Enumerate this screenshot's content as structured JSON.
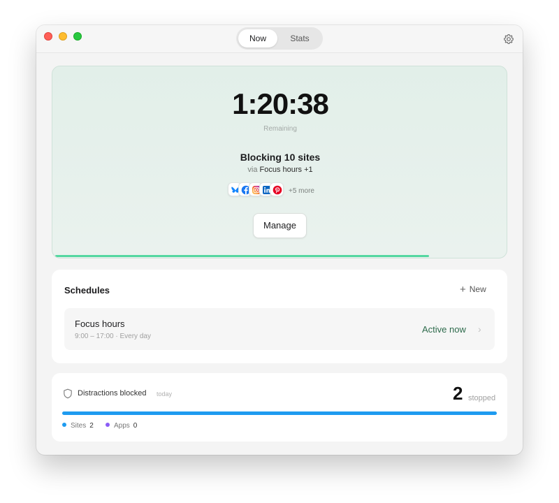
{
  "tabs": {
    "now": "Now",
    "stats": "Stats"
  },
  "focus": {
    "timer": "1:20:38",
    "remaining_label": "Remaining",
    "blocking_text": "Blocking 10 sites",
    "via_prefix": "via",
    "via_name": "Focus hours +1",
    "more_text": "+5 more",
    "manage_label": "Manage",
    "progress_fraction": 0.83,
    "site_icons": [
      "bluesky-icon",
      "facebook-icon",
      "instagram-icon",
      "linkedin-icon",
      "pinterest-icon"
    ],
    "accent": "#54d7a0"
  },
  "schedules": {
    "title": "Schedules",
    "new_label": "New",
    "items": [
      {
        "name": "Focus hours",
        "time": "9:00 – 17:00 · Every day",
        "status": "Active now"
      }
    ]
  },
  "distractions": {
    "title": "Distractions blocked",
    "period": "today",
    "count": "2",
    "unit": "stopped",
    "bar_fraction": 1.0,
    "legend": [
      {
        "label": "Sites",
        "value": "2",
        "color": "#1e9bf0"
      },
      {
        "label": "Apps",
        "value": "0",
        "color": "#8b5cf6"
      }
    ]
  }
}
